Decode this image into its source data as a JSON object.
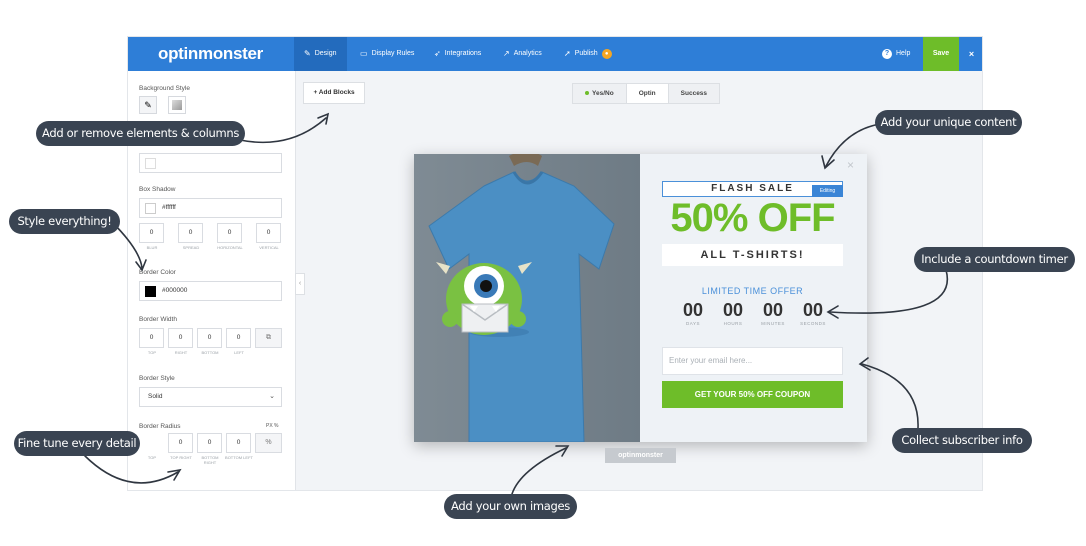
{
  "topbar": {
    "logo": "optinmonster",
    "nav": [
      {
        "label": "Design",
        "icon": "pencil-icon"
      },
      {
        "label": "Display Rules",
        "icon": "monitor-icon"
      },
      {
        "label": "Integrations",
        "icon": "plane-icon"
      },
      {
        "label": "Analytics",
        "icon": "chart-icon"
      },
      {
        "label": "Publish",
        "icon": "rocket-icon",
        "badge": "●"
      }
    ],
    "help": "Help",
    "help_icon": "?",
    "save": "Save",
    "close": "×"
  },
  "sidebar": {
    "background_style_label": "Background Style",
    "box_shadow_label": "Box Shadow",
    "box_shadow_color": "#ffffff",
    "shadow_values": [
      "0",
      "0",
      "0",
      "0"
    ],
    "shadow_sublabels": [
      "BLUR",
      "SPREAD",
      "HORIZONTAL",
      "VERTICAL"
    ],
    "border_color_label": "Border Color",
    "border_color_value": "#000000",
    "border_width_label": "Border Width",
    "border_width_values": [
      "0",
      "0",
      "0",
      "0"
    ],
    "border_width_sublabels": [
      "TOP",
      "RIGHT",
      "BOTTOM",
      "LEFT"
    ],
    "border_style_label": "Border Style",
    "border_style_value": "Solid",
    "border_radius_label": "Border Radius",
    "border_radius_unit": "PX %",
    "border_radius_values": [
      "0",
      "0",
      "0"
    ],
    "border_radius_sublabels": [
      "TOP",
      "TOP RIGHT",
      "BOTTOM RIGHT",
      "BOTTOM LEFT"
    ],
    "collapse_icon": "‹"
  },
  "canvas": {
    "add_blocks": "+ Add Blocks",
    "tabs": [
      "Yes/No",
      "Optin",
      "Success"
    ],
    "selected_tab": "Optin"
  },
  "popup": {
    "flash_sale": "FLASH SALE",
    "editing": "Editing",
    "headline": "50% OFF",
    "subheadline": "ALL T-SHIRTS!",
    "limited": "LIMITED TIME OFFER",
    "countdown": [
      {
        "value": "00",
        "label": "DAYS"
      },
      {
        "value": "00",
        "label": "HOURS"
      },
      {
        "value": "00",
        "label": "MINUTES"
      },
      {
        "value": "00",
        "label": "SECONDS"
      }
    ],
    "email_placeholder": "Enter your email here...",
    "cta": "GET YOUR 50% OFF COUPON",
    "close": "×",
    "powered_by": "optinmonster"
  },
  "callouts": {
    "add_remove": "Add or remove elements & columns",
    "style": "Style everything!",
    "fine_tune": "Fine tune every detail",
    "unique_content": "Add your unique content",
    "countdown": "Include a countdown timer",
    "subscriber": "Collect subscriber info",
    "images": "Add your own images"
  },
  "colors": {
    "brand_blue": "#2e7ed7",
    "green": "#6ebd29",
    "callout_bg": "#3a4452",
    "shirt_blue": "#4b8fc4"
  }
}
